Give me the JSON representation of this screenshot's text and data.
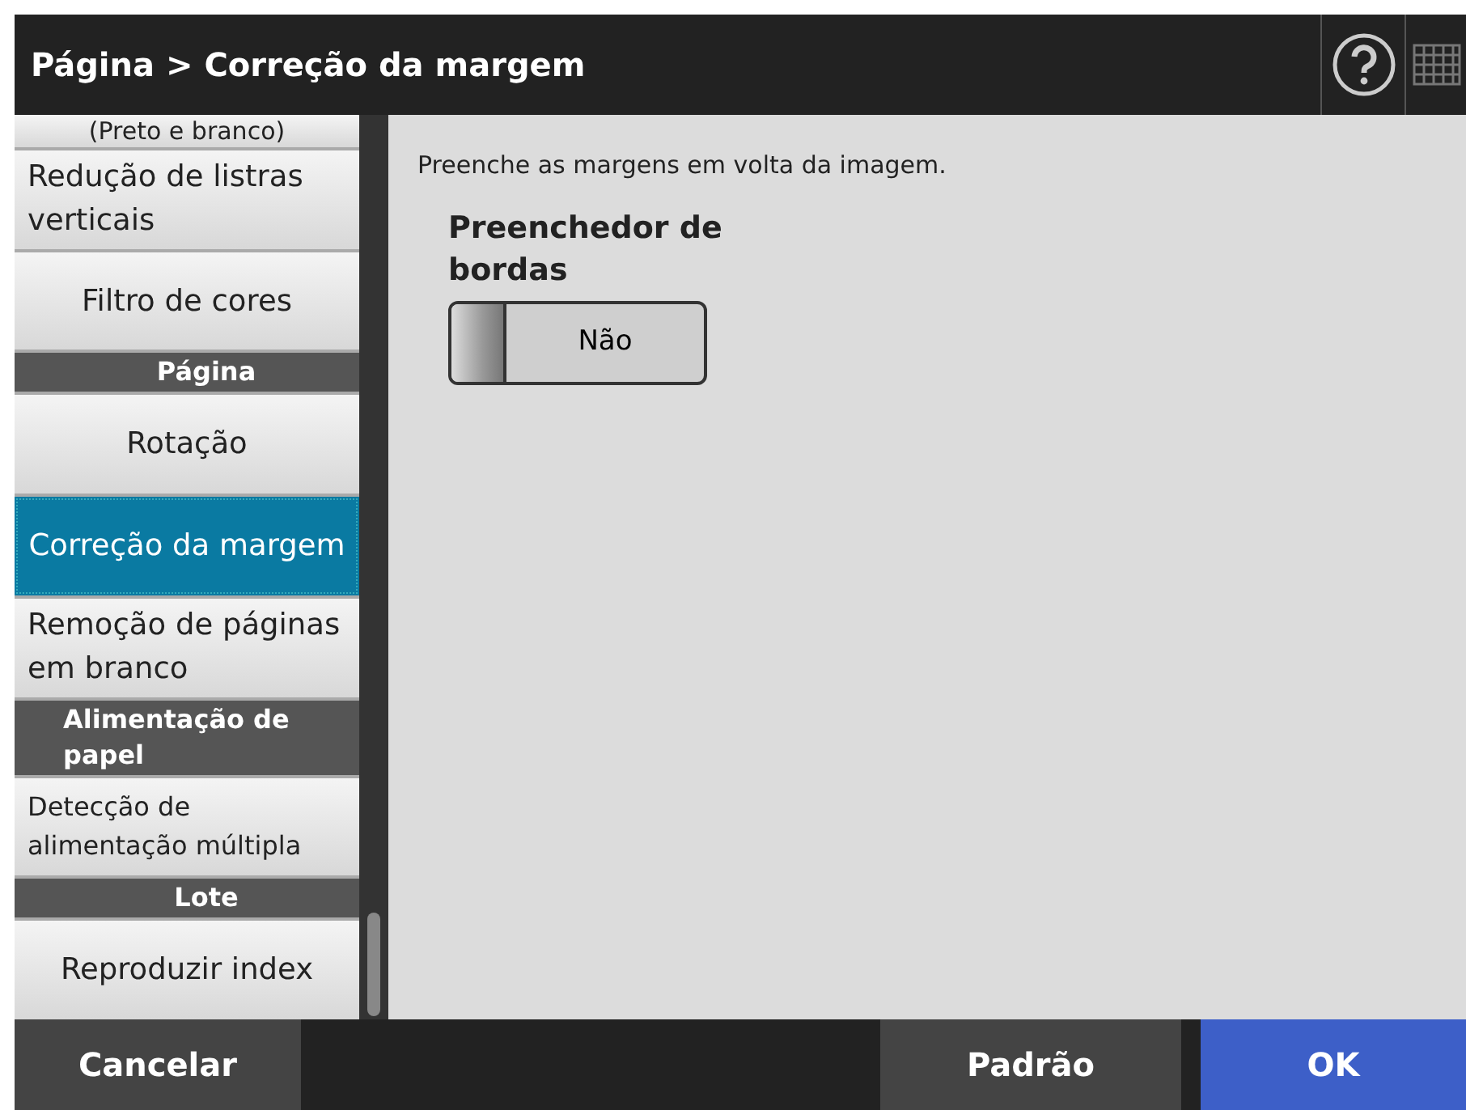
{
  "header": {
    "title": "Página > Correção da margem"
  },
  "sidebar": {
    "items": [
      {
        "kind": "item",
        "label": "(Preto e branco)",
        "selected": false
      },
      {
        "kind": "item",
        "label": "Redução de listras verticais",
        "selected": false
      },
      {
        "kind": "item",
        "label": "Filtro de cores",
        "selected": false
      },
      {
        "kind": "header",
        "label": "Página"
      },
      {
        "kind": "item",
        "label": "Rotação",
        "selected": false
      },
      {
        "kind": "item",
        "label": "Correção da margem",
        "selected": true
      },
      {
        "kind": "item",
        "label": "Remoção de páginas em branco",
        "selected": false
      },
      {
        "kind": "header",
        "label": "Alimentação de papel"
      },
      {
        "kind": "item",
        "label": "Detecção de alimentação múltipla",
        "selected": false
      },
      {
        "kind": "header",
        "label": "Lote"
      },
      {
        "kind": "item",
        "label": "Reproduzir index",
        "selected": false
      }
    ]
  },
  "content": {
    "description": "Preenche as margens em volta da imagem.",
    "setting": {
      "label": "Preenchedor de bordas",
      "value": "Não",
      "on": false
    }
  },
  "footer": {
    "buttons": [
      {
        "kind": "cancel",
        "label": "Cancelar"
      },
      {
        "kind": "default",
        "label": "Padrão"
      },
      {
        "kind": "ok",
        "label": "OK"
      }
    ]
  }
}
